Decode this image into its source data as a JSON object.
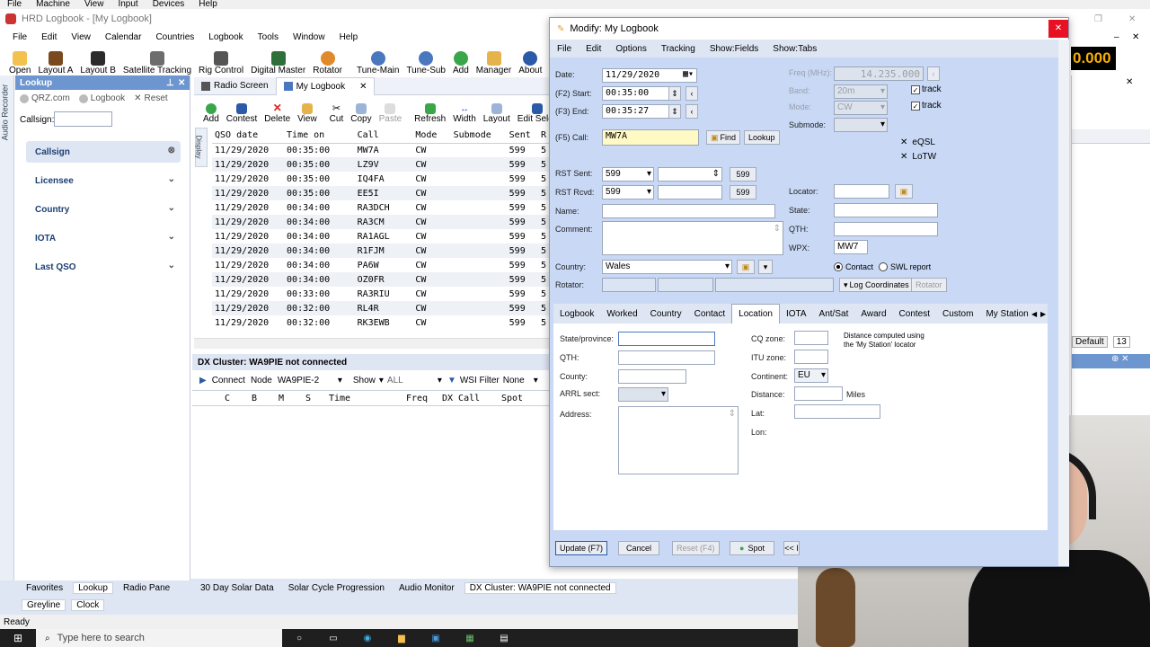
{
  "main_window": {
    "system_menu": [
      "File",
      "Machine",
      "View",
      "Input",
      "Devices",
      "Help"
    ],
    "title": "HRD Logbook - [My Logbook]",
    "menu": [
      "File",
      "Edit",
      "View",
      "Calendar",
      "Countries",
      "Logbook",
      "Tools",
      "Window",
      "Help"
    ],
    "toolbar": [
      "Open",
      "Layout A",
      "Layout B",
      "Satellite Tracking",
      "Rig Control",
      "Digital Master",
      "Rotator",
      "Tune-Main",
      "Tune-Sub",
      "Add",
      "Manager",
      "About"
    ],
    "freq_partial": "0.000"
  },
  "lookup_panel": {
    "title": "Lookup",
    "side_label": "Audio Recorder",
    "qrz": "QRZ.com",
    "logbook": "Logbook",
    "reset": "Reset",
    "callsign_label": "Callsign:",
    "callsign_value": "",
    "sections": [
      "Callsign",
      "Licensee",
      "Country",
      "IOTA",
      "Last QSO"
    ]
  },
  "doc_tabs": {
    "radio_screen": "Radio Screen",
    "my_logbook": "My Logbook"
  },
  "logbook_toolbar": [
    "Add",
    "Contest",
    "Delete",
    "View",
    "Cut",
    "Copy",
    "Paste",
    "Refresh",
    "Width",
    "Layout",
    "Edit Selec"
  ],
  "side_display_label": "Display",
  "log_table": {
    "headers": [
      "QSO date",
      "Time on",
      "Call",
      "Mode",
      "Submode",
      "Sent",
      "R"
    ],
    "rows": [
      [
        "11/29/2020",
        "00:35:00",
        "MW7A",
        "CW",
        "",
        "599",
        "5"
      ],
      [
        "11/29/2020",
        "00:35:00",
        "LZ9V",
        "CW",
        "",
        "599",
        "5"
      ],
      [
        "11/29/2020",
        "00:35:00",
        "IQ4FA",
        "CW",
        "",
        "599",
        "5"
      ],
      [
        "11/29/2020",
        "00:35:00",
        "EE5I",
        "CW",
        "",
        "599",
        "5"
      ],
      [
        "11/29/2020",
        "00:34:00",
        "RA3DCH",
        "CW",
        "",
        "599",
        "5"
      ],
      [
        "11/29/2020",
        "00:34:00",
        "RA3CM",
        "CW",
        "",
        "599",
        "5"
      ],
      [
        "11/29/2020",
        "00:34:00",
        "RA1AGL",
        "CW",
        "",
        "599",
        "5"
      ],
      [
        "11/29/2020",
        "00:34:00",
        "R1FJM",
        "CW",
        "",
        "599",
        "5"
      ],
      [
        "11/29/2020",
        "00:34:00",
        "PA6W",
        "CW",
        "",
        "599",
        "5"
      ],
      [
        "11/29/2020",
        "00:34:00",
        "OZ0FR",
        "CW",
        "",
        "599",
        "5"
      ],
      [
        "11/29/2020",
        "00:33:00",
        "RA3RIU",
        "CW",
        "",
        "599",
        "5"
      ],
      [
        "11/29/2020",
        "00:32:00",
        "RL4R",
        "CW",
        "",
        "599",
        "5"
      ],
      [
        "11/29/2020",
        "00:32:00",
        "RK3EWB",
        "CW",
        "",
        "599",
        "5"
      ]
    ]
  },
  "dx_cluster": {
    "title": "DX Cluster: WA9PIE not connected",
    "connect": "Connect",
    "node_label": "Node",
    "node_value": "WA9PIE-2",
    "show_label": "Show",
    "show_value": "ALL",
    "filter_label": "WSI Filter",
    "filter_value": "None",
    "headers": [
      "C",
      "B",
      "M",
      "S",
      "Time",
      "Freq",
      "DX Call",
      "Spot"
    ]
  },
  "right_bg": {
    "default": "Default",
    "count": "13"
  },
  "bottom_tabs_left": [
    "Favorites",
    "Lookup",
    "Radio Pane"
  ],
  "bottom_tabs_left2": [
    "Greyline",
    "Clock"
  ],
  "bottom_tabs_center": [
    "30 Day Solar Data",
    "Solar Cycle Progression",
    "Audio Monitor",
    "DX Cluster: WA9PIE not connected"
  ],
  "status": "Ready",
  "taskbar": {
    "search_placeholder": "Type here to search"
  },
  "dialog": {
    "title": "Modify: My Logbook",
    "menu": [
      "File",
      "Edit",
      "Options",
      "Tracking",
      "Show:Fields",
      "Show:Tabs"
    ],
    "date_label": "Date:",
    "date_value": "11/29/2020",
    "start_label": "(F2) Start:",
    "start_value": "00:35:00",
    "end_label": "(F3) End:",
    "end_value": "00:35:27",
    "call_label": "(F5) Call:",
    "call_value": "MW7A",
    "find": "Find",
    "lookup": "Lookup",
    "freq_label": "Freq (MHz):",
    "freq_value": "14.235.000",
    "band_label": "Band:",
    "band_value": "20m",
    "mode_label": "Mode:",
    "mode_value": "CW",
    "submode_label": "Submode:",
    "track": "track",
    "eqsl": "eQSL",
    "lotw": "LoTW",
    "rst_sent_label": "RST Sent:",
    "rst_sent_value": "599",
    "rst_rcvd_label": "RST Rcvd:",
    "rst_rcvd_value": "599",
    "rst_btn": "599",
    "name_label": "Name:",
    "comment_label": "Comment:",
    "locator_label": "Locator:",
    "state_label": "State:",
    "qth_label": "QTH:",
    "wpx_label": "WPX:",
    "wpx_value": "MW7",
    "country_label": "Country:",
    "country_value": "Wales",
    "contact": "Contact",
    "swl": "SWL report",
    "rotator_label": "Rotator:",
    "log_coords": "Log Coordinates",
    "rotator_btn": "Rotator",
    "tabs": [
      "Logbook",
      "Worked",
      "Country",
      "Contact",
      "Location",
      "IOTA",
      "Ant/Sat",
      "Award",
      "Contest",
      "Custom",
      "My Station"
    ],
    "active_tab": "Location",
    "loc": {
      "state_province": "State/province:",
      "qth": "QTH:",
      "county": "County:",
      "arrl": "ARRL sect:",
      "address": "Address:",
      "cq_zone": "CQ zone:",
      "itu_zone": "ITU zone:",
      "continent": "Continent:",
      "continent_value": "EU",
      "distance": "Distance:",
      "miles": "Miles",
      "lat": "Lat:",
      "lon": "Lon:",
      "note": "Distance computed using the 'My Station' locator"
    },
    "update": "Update (F7)",
    "cancel": "Cancel",
    "reset": "Reset (F4)",
    "spot": "Spot",
    "more": "<< I"
  },
  "colors": {
    "accent": "#1d4f91",
    "dialog_bg": "#c8d8f5",
    "close_red": "#e81123",
    "yellow_field": "#fff9c4"
  }
}
